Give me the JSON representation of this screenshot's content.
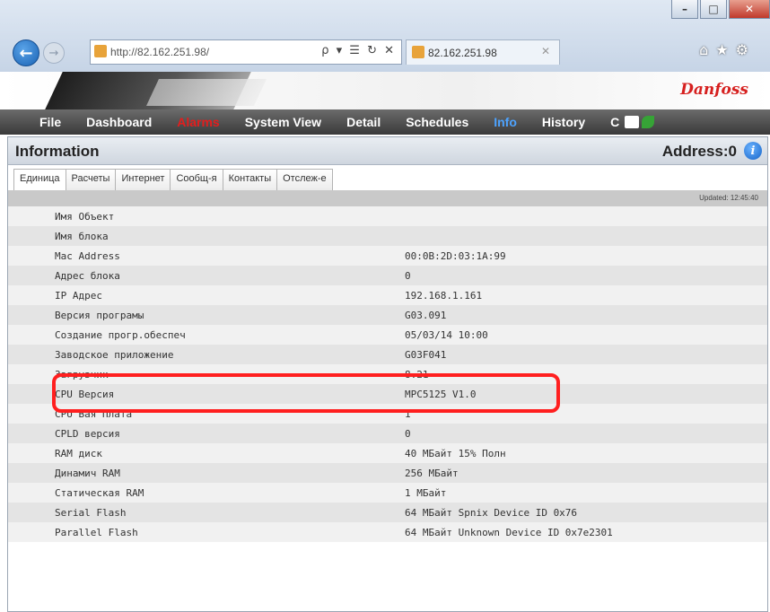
{
  "browser": {
    "url": "http://82.162.251.98/",
    "address_tools": "ρ ▾ ☰ ↻ ✕",
    "tab_title": "82.162.251.98",
    "window_controls": [
      "–",
      "□",
      "✕"
    ]
  },
  "brand": {
    "logo_text": "Danfoss"
  },
  "menu": {
    "items": [
      "File",
      "Dashboard",
      "Alarms",
      "System View",
      "Detail",
      "Schedules",
      "Info",
      "History",
      "C"
    ]
  },
  "panel": {
    "title": "Information",
    "address_label": "Address:0",
    "tabs": [
      "Единица",
      "Расчеты",
      "Интернет",
      "Сообщ-я",
      "Контакты",
      "Отслеж-е"
    ],
    "active_tab": 0,
    "updated": "Updated: 12:45:40",
    "rows": [
      {
        "label": "Имя Объект",
        "value": ""
      },
      {
        "label": "Имя блока",
        "value": ""
      },
      {
        "label": "Mac Address",
        "value": "00:0B:2D:03:1A:99"
      },
      {
        "label": "Адрес блока",
        "value": "0"
      },
      {
        "label": "IP Адрес",
        "value": "192.168.1.161"
      },
      {
        "label": "Версия програмы",
        "value": "G03.091"
      },
      {
        "label": "Создание прогр.обеспеч",
        "value": "05/03/14 10:00"
      },
      {
        "label": "Заводское приложение",
        "value": "G03F041"
      },
      {
        "label": "Загрузчик",
        "value": "8.21"
      },
      {
        "label": "CPU Версия",
        "value": "MPC5125 V1.0"
      },
      {
        "label": "CPU Вая Плата",
        "value": "1"
      },
      {
        "label": "CPLD версия",
        "value": "0"
      },
      {
        "label": "RAM диск",
        "value": "40 МБайт 15% Полн"
      },
      {
        "label": "Динамич RAM",
        "value": "256 МБайт"
      },
      {
        "label": "Статическая RAM",
        "value": "1 МБайт"
      },
      {
        "label": "Serial Flash",
        "value": "64 МБайт   Spnix Device ID 0x76"
      },
      {
        "label": "Parallel Flash",
        "value": "64 МБайт   Unknown Device ID 0x7e2301"
      }
    ],
    "highlighted_row": 7
  },
  "colors": {
    "alarm": "#e31d1d",
    "info_active": "#4da3ff",
    "highlight": "#ff1f1f"
  }
}
